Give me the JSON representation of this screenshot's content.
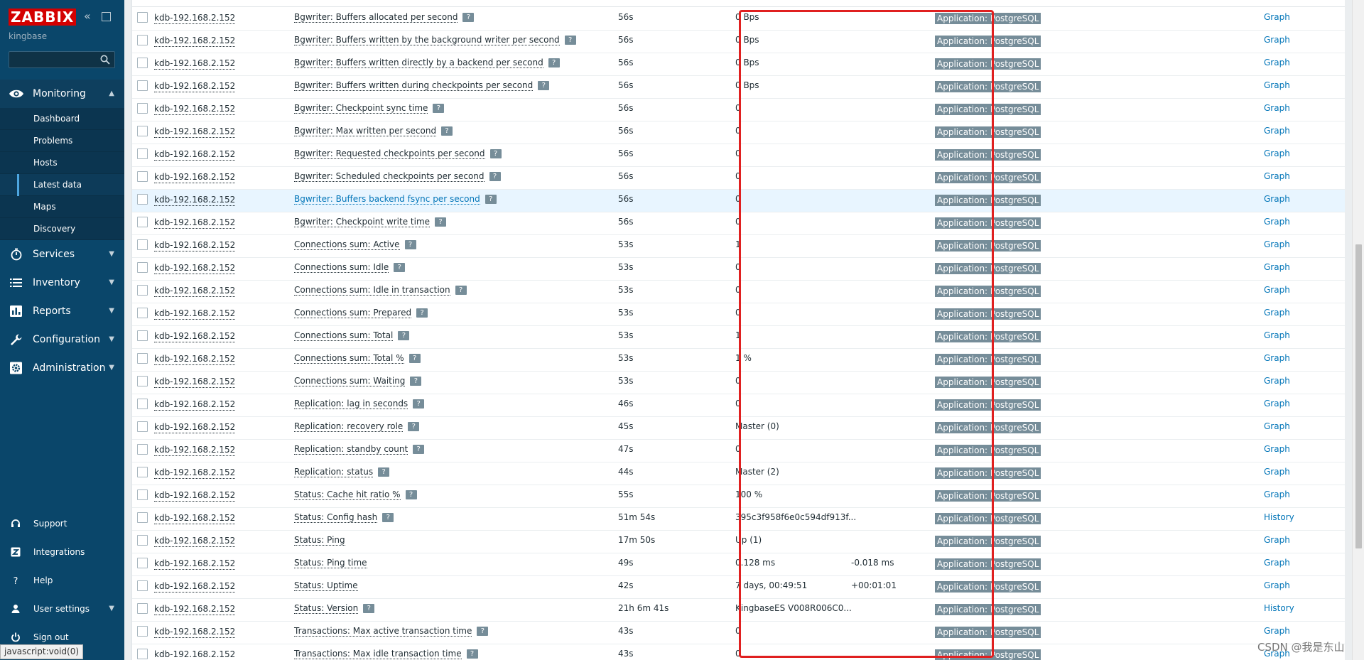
{
  "sidebar": {
    "logo": "ZABBIX",
    "server_name": "kingbase",
    "search": {
      "placeholder": ""
    },
    "menu": {
      "monitoring": "Monitoring",
      "submenu": [
        "Dashboard",
        "Problems",
        "Hosts",
        "Latest data",
        "Maps",
        "Discovery"
      ],
      "services": "Services",
      "inventory": "Inventory",
      "reports": "Reports",
      "configuration": "Configuration",
      "administration": "Administration"
    },
    "bottom": {
      "support": "Support",
      "integrations": "Integrations",
      "help": "Help",
      "user_settings": "User settings",
      "sign_out": "Sign out"
    }
  },
  "status_bar": "javascript:void(0)",
  "watermark": "CSDN @我是东山",
  "colors": {
    "sidebar": "#0a466a",
    "logo": "#d40000",
    "link": "#0275b8",
    "tag": "#768d99",
    "highlight": "#e02020"
  },
  "rows": [
    {
      "host": "kdb-192.168.2.152",
      "item": "Bgwriter: Buffers allocated per second",
      "help": true,
      "last_check": "56s",
      "last_value": "0 Bps",
      "change": "",
      "tag": "Application: PostgreSQL",
      "link": "Graph"
    },
    {
      "host": "kdb-192.168.2.152",
      "item": "Bgwriter: Buffers written by the background writer per second",
      "help": true,
      "last_check": "56s",
      "last_value": "0 Bps",
      "change": "",
      "tag": "Application: PostgreSQL",
      "link": "Graph"
    },
    {
      "host": "kdb-192.168.2.152",
      "item": "Bgwriter: Buffers written directly by a backend per second",
      "help": true,
      "last_check": "56s",
      "last_value": "0 Bps",
      "change": "",
      "tag": "Application: PostgreSQL",
      "link": "Graph"
    },
    {
      "host": "kdb-192.168.2.152",
      "item": "Bgwriter: Buffers written during checkpoints per second",
      "help": true,
      "last_check": "56s",
      "last_value": "0 Bps",
      "change": "",
      "tag": "Application: PostgreSQL",
      "link": "Graph"
    },
    {
      "host": "kdb-192.168.2.152",
      "item": "Bgwriter: Checkpoint sync time",
      "help": true,
      "last_check": "56s",
      "last_value": "0",
      "change": "",
      "tag": "Application: PostgreSQL",
      "link": "Graph"
    },
    {
      "host": "kdb-192.168.2.152",
      "item": "Bgwriter: Max written per second",
      "help": true,
      "last_check": "56s",
      "last_value": "0",
      "change": "",
      "tag": "Application: PostgreSQL",
      "link": "Graph"
    },
    {
      "host": "kdb-192.168.2.152",
      "item": "Bgwriter: Requested checkpoints per second",
      "help": true,
      "last_check": "56s",
      "last_value": "0",
      "change": "",
      "tag": "Application: PostgreSQL",
      "link": "Graph"
    },
    {
      "host": "kdb-192.168.2.152",
      "item": "Bgwriter: Scheduled checkpoints per second",
      "help": true,
      "last_check": "56s",
      "last_value": "0",
      "change": "",
      "tag": "Application: PostgreSQL",
      "link": "Graph"
    },
    {
      "host": "kdb-192.168.2.152",
      "item": "Bgwriter: Buffers backend fsync per second",
      "help": true,
      "last_check": "56s",
      "last_value": "0",
      "change": "",
      "tag": "Application: PostgreSQL",
      "link": "Graph",
      "highlighted": true
    },
    {
      "host": "kdb-192.168.2.152",
      "item": "Bgwriter: Checkpoint write time",
      "help": true,
      "last_check": "56s",
      "last_value": "0",
      "change": "",
      "tag": "Application: PostgreSQL",
      "link": "Graph"
    },
    {
      "host": "kdb-192.168.2.152",
      "item": "Connections sum: Active",
      "help": true,
      "last_check": "53s",
      "last_value": "1",
      "change": "",
      "tag": "Application: PostgreSQL",
      "link": "Graph"
    },
    {
      "host": "kdb-192.168.2.152",
      "item": "Connections sum: Idle",
      "help": true,
      "last_check": "53s",
      "last_value": "0",
      "change": "",
      "tag": "Application: PostgreSQL",
      "link": "Graph"
    },
    {
      "host": "kdb-192.168.2.152",
      "item": "Connections sum: Idle in transaction",
      "help": true,
      "last_check": "53s",
      "last_value": "0",
      "change": "",
      "tag": "Application: PostgreSQL",
      "link": "Graph"
    },
    {
      "host": "kdb-192.168.2.152",
      "item": "Connections sum: Prepared",
      "help": true,
      "last_check": "53s",
      "last_value": "0",
      "change": "",
      "tag": "Application: PostgreSQL",
      "link": "Graph"
    },
    {
      "host": "kdb-192.168.2.152",
      "item": "Connections sum: Total",
      "help": true,
      "last_check": "53s",
      "last_value": "1",
      "change": "",
      "tag": "Application: PostgreSQL",
      "link": "Graph"
    },
    {
      "host": "kdb-192.168.2.152",
      "item": "Connections sum: Total %",
      "help": true,
      "last_check": "53s",
      "last_value": "1 %",
      "change": "",
      "tag": "Application: PostgreSQL",
      "link": "Graph"
    },
    {
      "host": "kdb-192.168.2.152",
      "item": "Connections sum: Waiting",
      "help": true,
      "last_check": "53s",
      "last_value": "0",
      "change": "",
      "tag": "Application: PostgreSQL",
      "link": "Graph"
    },
    {
      "host": "kdb-192.168.2.152",
      "item": "Replication: lag in seconds",
      "help": true,
      "last_check": "46s",
      "last_value": "0",
      "change": "",
      "tag": "Application: PostgreSQL",
      "link": "Graph"
    },
    {
      "host": "kdb-192.168.2.152",
      "item": "Replication: recovery role",
      "help": true,
      "last_check": "45s",
      "last_value": "Master (0)",
      "change": "",
      "tag": "Application: PostgreSQL",
      "link": "Graph"
    },
    {
      "host": "kdb-192.168.2.152",
      "item": "Replication: standby count",
      "help": true,
      "last_check": "47s",
      "last_value": "0",
      "change": "",
      "tag": "Application: PostgreSQL",
      "link": "Graph"
    },
    {
      "host": "kdb-192.168.2.152",
      "item": "Replication: status",
      "help": true,
      "last_check": "44s",
      "last_value": "Master (2)",
      "change": "",
      "tag": "Application: PostgreSQL",
      "link": "Graph"
    },
    {
      "host": "kdb-192.168.2.152",
      "item": "Status: Cache hit ratio %",
      "help": true,
      "last_check": "55s",
      "last_value": "100 %",
      "change": "",
      "tag": "Application: PostgreSQL",
      "link": "Graph"
    },
    {
      "host": "kdb-192.168.2.152",
      "item": "Status: Config hash",
      "help": true,
      "last_check": "51m 54s",
      "last_value": "395c3f958f6e0c594df913f...",
      "change": "",
      "tag": "Application: PostgreSQL",
      "link": "History"
    },
    {
      "host": "kdb-192.168.2.152",
      "item": "Status: Ping",
      "help": false,
      "last_check": "17m 50s",
      "last_value": "Up (1)",
      "change": "",
      "tag": "Application: PostgreSQL",
      "link": "Graph"
    },
    {
      "host": "kdb-192.168.2.152",
      "item": "Status: Ping time",
      "help": false,
      "last_check": "49s",
      "last_value": "0.128 ms",
      "change": "-0.018 ms",
      "tag": "Application: PostgreSQL",
      "link": "Graph"
    },
    {
      "host": "kdb-192.168.2.152",
      "item": "Status: Uptime",
      "help": false,
      "last_check": "42s",
      "last_value": "7 days, 00:49:51",
      "change": "+00:01:01",
      "tag": "Application: PostgreSQL",
      "link": "Graph"
    },
    {
      "host": "kdb-192.168.2.152",
      "item": "Status: Version",
      "help": true,
      "last_check": "21h 6m 41s",
      "last_value": "KingbaseES V008R006C0...",
      "change": "",
      "tag": "Application: PostgreSQL",
      "link": "History"
    },
    {
      "host": "kdb-192.168.2.152",
      "item": "Transactions: Max active transaction time",
      "help": true,
      "last_check": "43s",
      "last_value": "0",
      "change": "",
      "tag": "Application: PostgreSQL",
      "link": "Graph"
    },
    {
      "host": "kdb-192.168.2.152",
      "item": "Transactions: Max idle transaction time",
      "help": true,
      "last_check": "43s",
      "last_value": "0",
      "change": "",
      "tag": "Application: PostgreSQL",
      "link": "Graph"
    }
  ]
}
